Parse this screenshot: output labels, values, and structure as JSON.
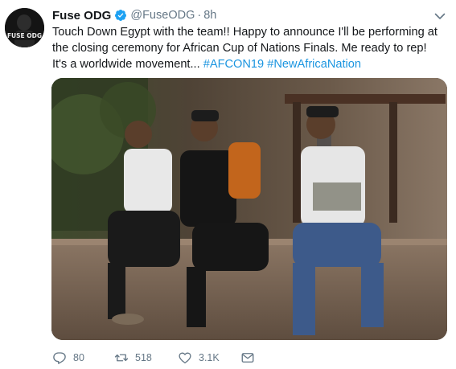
{
  "tweet": {
    "author_name": "Fuse ODG",
    "handle": "@FuseODG",
    "separator": "·",
    "time": "8h",
    "text_plain": "Touch Down Egypt with the team!! Happy to announce I'll be performing at the closing ceremony for African Cup of Nations Finals. Me ready to rep! It's a worldwide movement... ",
    "hashtags": [
      "#AFCON19",
      "#NewAfricaNation"
    ],
    "verified_icon": "verified-badge-icon",
    "media_alt": "photo"
  },
  "avatar": {
    "text": "FUSE ODG"
  },
  "actions": {
    "reply_count": "80",
    "retweet_count": "518",
    "like_count": "3.1K"
  },
  "colors": {
    "link": "#1b95e0",
    "secondary": "#657786",
    "verified": "#1da1f2"
  }
}
